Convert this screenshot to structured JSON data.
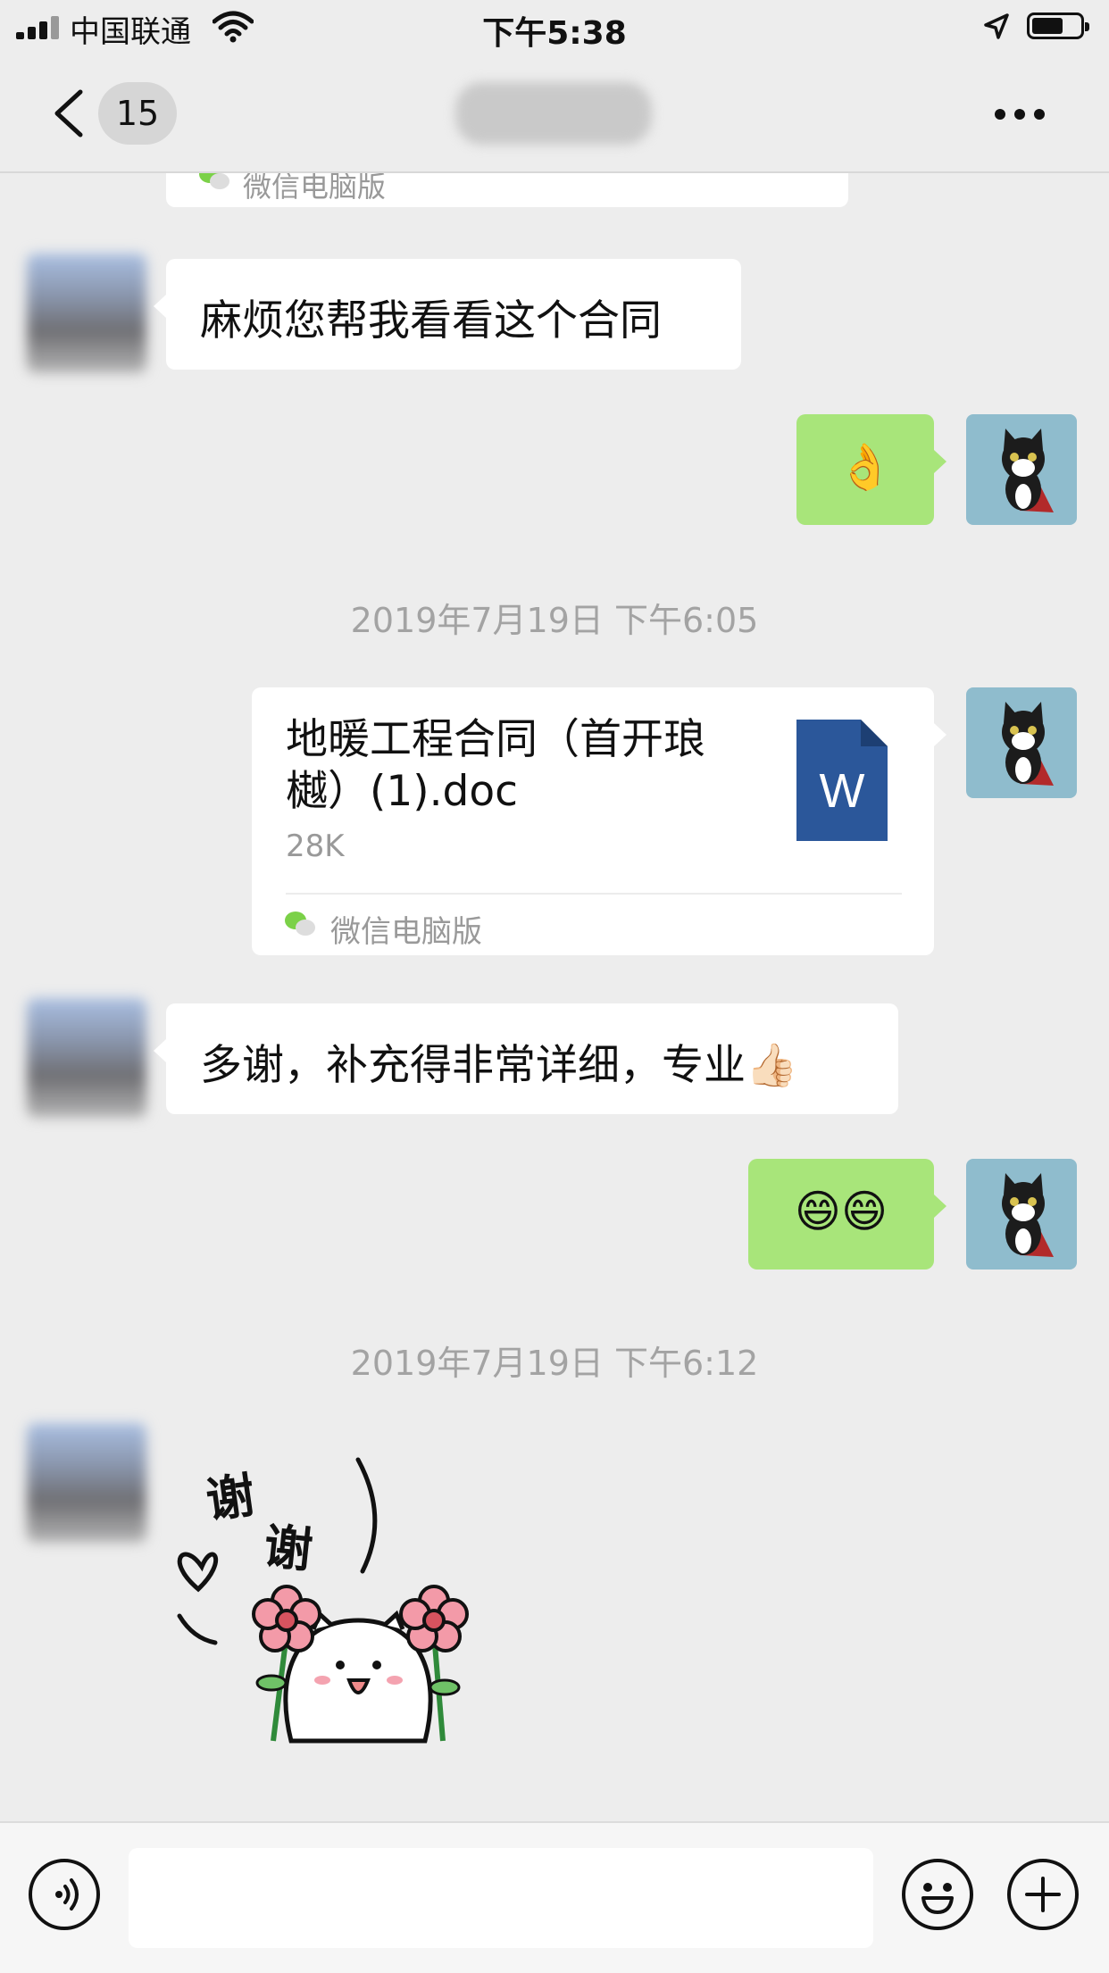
{
  "status_bar": {
    "carrier": "中国联通",
    "time": "下午5:38"
  },
  "nav": {
    "back_badge": "15",
    "title_blurred": true
  },
  "messages": [
    {
      "type": "text",
      "from": "other",
      "text": "麻烦您帮我看看这个合同"
    },
    {
      "type": "emoji",
      "from": "me",
      "emoji": "👌"
    },
    {
      "type": "timestamp",
      "text": "2019年7月19日 下午6:05"
    },
    {
      "type": "file",
      "from": "me",
      "file_name": "地暖工程合同（首开琅樾）(1).doc",
      "file_size": "28K",
      "source": "微信电脑版",
      "icon": "word-doc-icon"
    },
    {
      "type": "text",
      "from": "other",
      "text": "多谢，补充得非常详细，专业",
      "emoji": "👍🏻"
    },
    {
      "type": "emoji",
      "from": "me",
      "emoji": "😄😄"
    },
    {
      "type": "timestamp",
      "text": "2019年7月19日 下午6:12"
    },
    {
      "type": "sticker",
      "from": "other",
      "sticker_text": "谢谢"
    }
  ],
  "top_partial_bubble": {
    "source": "微信电脑版"
  },
  "input_bar": {
    "value": "",
    "placeholder": ""
  },
  "colors": {
    "background": "#ededed",
    "outgoing_bubble": "#a8e57a",
    "incoming_bubble": "#ffffff",
    "word_icon": "#2b579a"
  }
}
